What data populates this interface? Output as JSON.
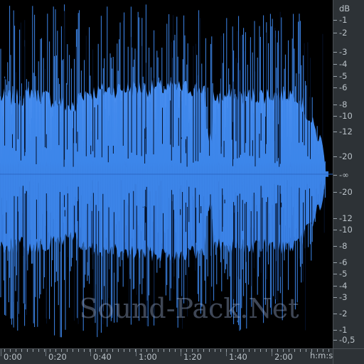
{
  "app": {
    "waveform_color": "#3d86ea",
    "waveform_edge_color": "#2f6ed1",
    "background_color": "#000000",
    "ruler_color": "#2d3236",
    "ruler_text_color": "#b9c1c7"
  },
  "db_scale": {
    "unit_label": "dB",
    "labels": [
      "-1",
      "-2",
      "-3",
      "-4",
      "-5",
      "-6",
      "-8",
      "-10",
      "-12",
      "-20",
      "-∞",
      "-20",
      "-12",
      "-10",
      "-8",
      "-6",
      "-5",
      "-4",
      "-3",
      "-2",
      "-1",
      "-0,5"
    ]
  },
  "time_ruler": {
    "labels": [
      "0:00",
      "0:20",
      "0:40",
      "1:00",
      "1:20",
      "1:40",
      "2:00"
    ],
    "unit_label": "h:m:s"
  },
  "watermark": "Sound-Pack.Net"
}
